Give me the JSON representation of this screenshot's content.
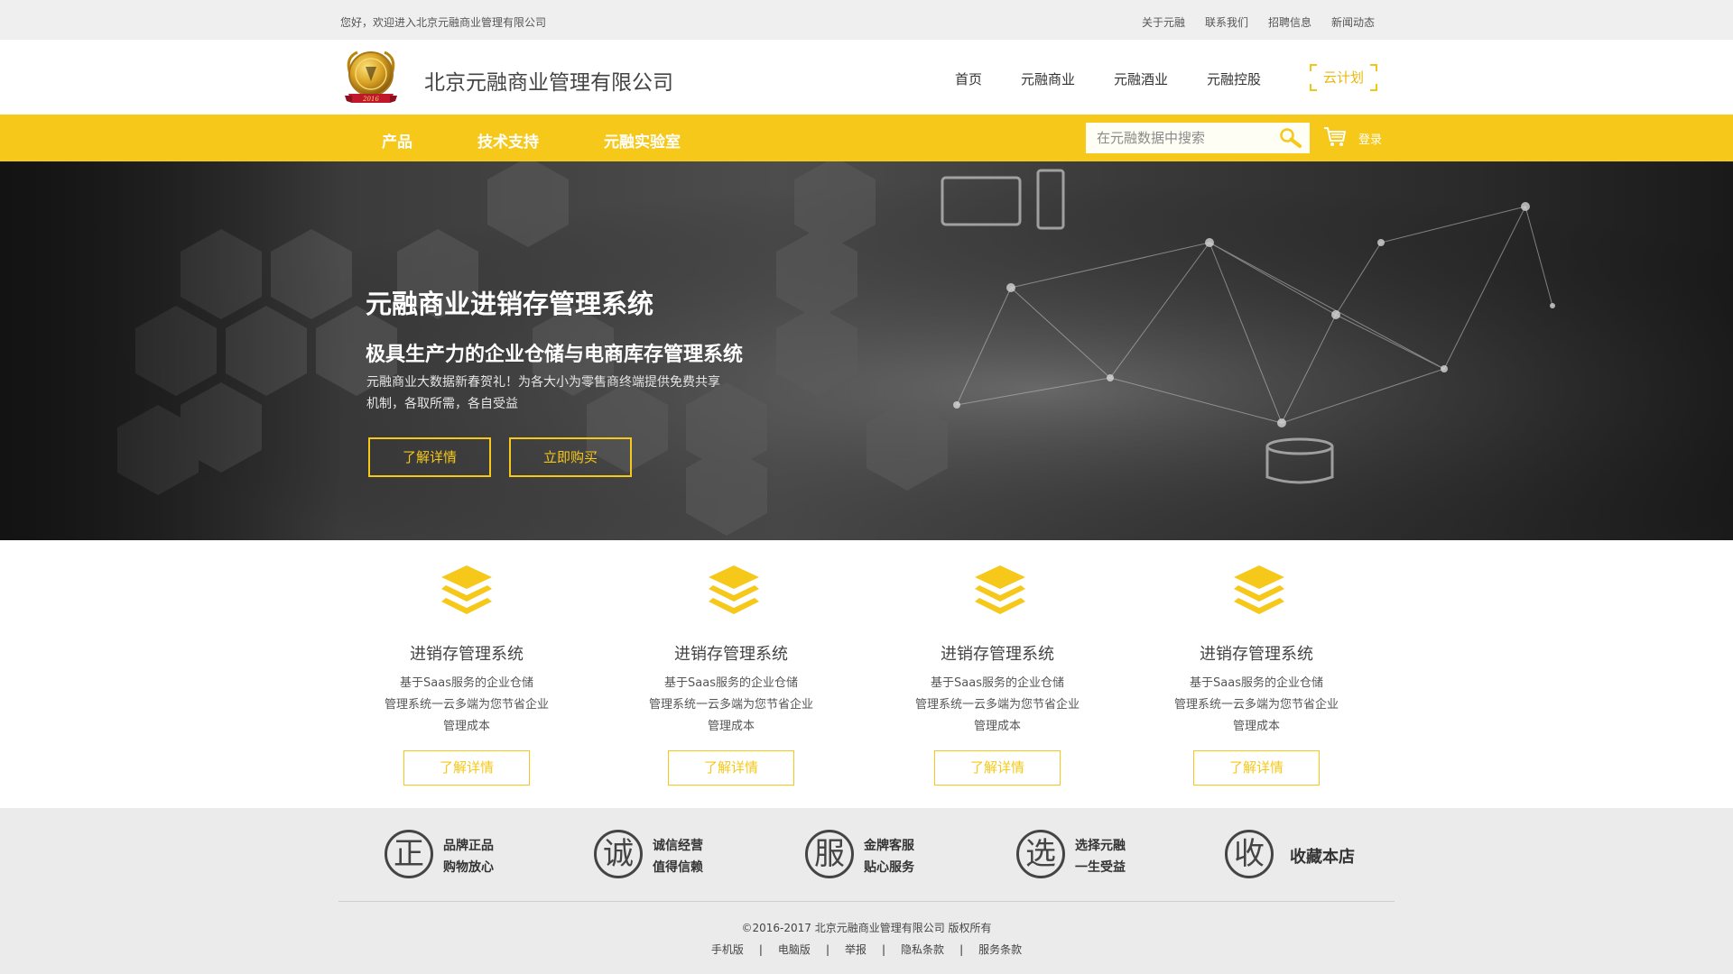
{
  "topbar": {
    "welcome": "您好，欢迎进入北京元融商业管理有限公司",
    "links": [
      "关于元融",
      "联系我们",
      "招聘信息",
      "新闻动态"
    ]
  },
  "header": {
    "company_name": "北京元融商业管理有限公司",
    "logo_year": "2016",
    "nav": [
      "首页",
      "元融商业",
      "元融酒业",
      "元融控股"
    ],
    "cloud_plan": "云计划"
  },
  "subnav": {
    "items": [
      "产品",
      "技术支持",
      "元融实验室"
    ],
    "search_placeholder": "在元融数据中搜索",
    "login": "登录"
  },
  "banner": {
    "title": "元融商业进销存管理系统",
    "subtitle": "极具生产力的企业仓储与电商库存管理系统",
    "desc_line1": "元融商业大数据新春贺礼！为各大小为零售商终端提供免费共享",
    "desc_line2": "机制，各取所需，各自受益",
    "btn_details": "了解详情",
    "btn_buy": "立即购买"
  },
  "features": [
    {
      "title": "进销存管理系统",
      "desc1": "基于Saas服务的企业仓储",
      "desc2": "管理系统一云多端为您节省企业",
      "desc3": "管理成本",
      "btn": "了解详情"
    },
    {
      "title": "进销存管理系统",
      "desc1": "基于Saas服务的企业仓储",
      "desc2": "管理系统一云多端为您节省企业",
      "desc3": "管理成本",
      "btn": "了解详情"
    },
    {
      "title": "进销存管理系统",
      "desc1": "基于Saas服务的企业仓储",
      "desc2": "管理系统一云多端为您节省企业",
      "desc3": "管理成本",
      "btn": "了解详情"
    },
    {
      "title": "进销存管理系统",
      "desc1": "基于Saas服务的企业仓储",
      "desc2": "管理系统一云多端为您节省企业",
      "desc3": "管理成本",
      "btn": "了解详情"
    }
  ],
  "guarantees": [
    {
      "char": "正",
      "line1": "品牌正品",
      "line2": "购物放心"
    },
    {
      "char": "诚",
      "line1": "诚信经营",
      "line2": "值得信赖"
    },
    {
      "char": "服",
      "line1": "金牌客服",
      "line2": "贴心服务"
    },
    {
      "char": "选",
      "line1": "选择元融",
      "line2": "一生受益"
    },
    {
      "char": "收",
      "line1": "收藏本店"
    }
  ],
  "footer": {
    "copyright": "©2016-2017  北京元融商业管理有限公司  版权所有",
    "links": [
      "手机版",
      "电脑版",
      "举报",
      "隐私条款",
      "服务条款"
    ],
    "separator": "|"
  },
  "colors": {
    "accent": "#f5c81a",
    "accent_text": "#e8b90c",
    "banner_dark": "#2a2a2a",
    "footer_bg": "#ebebeb"
  }
}
